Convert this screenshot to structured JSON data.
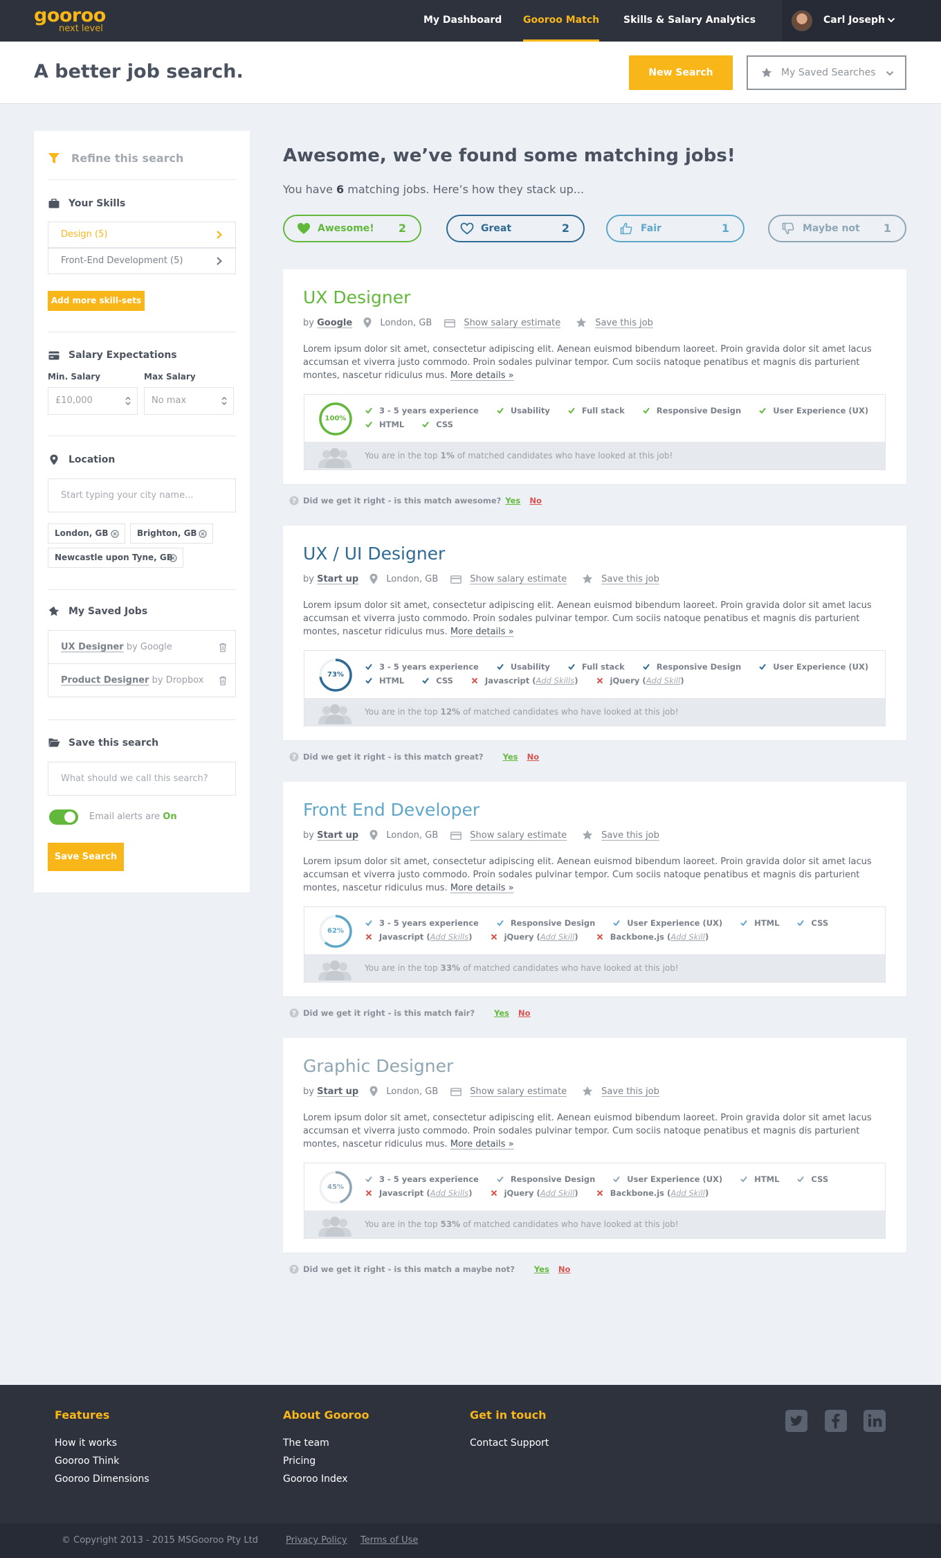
{
  "brand": {
    "name": "gooroo",
    "tagline": "next level",
    "accent": "#f8b619"
  },
  "nav": {
    "links": [
      "My Dashboard",
      "Gooroo Match",
      "Skills & Salary Analytics"
    ],
    "active": "Gooroo Match",
    "user_name": "Carl Joseph"
  },
  "header": {
    "title": "A better job search.",
    "new_search": "New Search",
    "saved_searches": "My Saved Searches"
  },
  "sidebar": {
    "refine": "Refine this search",
    "skills_title": "Your Skills",
    "skills": [
      {
        "label": "Design (5)",
        "active": true
      },
      {
        "label": "Front-End Development (5)",
        "active": false
      }
    ],
    "add_skills": "Add more skill-sets",
    "salary_title": "Salary Expectations",
    "min_label": "Min. Salary",
    "max_label": "Max Salary",
    "min_value": "£10,000",
    "max_value": "No max",
    "location_title": "Location",
    "location_placeholder": "Start typing your city name...",
    "locations": [
      "London, GB",
      "Brighton, GB",
      "Newcastle upon Tyne, GB"
    ],
    "saved_jobs_title": "My Saved Jobs",
    "saved_jobs": [
      {
        "title": "UX Designer",
        "by": "by Google"
      },
      {
        "title": "Product Designer",
        "by": "by Dropbox"
      }
    ],
    "save_search_title": "Save this search",
    "save_placeholder": "What should we call this search?",
    "alerts_label": "Email alerts are",
    "alerts_state": "On",
    "save_button": "Save Search"
  },
  "main": {
    "title": "Awesome, we’ve found some matching jobs!",
    "sub_prefix": "You have",
    "sub_count": "6",
    "sub_suffix": "matching jobs. Here’s how they stack up...",
    "filters": [
      {
        "label": "Awesome!",
        "count": "2",
        "color": "#61b83a",
        "icon": "heart-filled-icon"
      },
      {
        "label": "Great",
        "count": "2",
        "color": "#2e6a93",
        "icon": "heart-outline-icon"
      },
      {
        "label": "Fair",
        "count": "1",
        "color": "#5ea7c9",
        "icon": "thumbs-up-icon"
      },
      {
        "label": "Maybe not",
        "count": "1",
        "color": "#8fa6b5",
        "icon": "thumbs-down-icon"
      }
    ]
  },
  "common": {
    "by": "by",
    "location": "London, GB",
    "salary": "Show salary estimate",
    "save_job": "Save this job",
    "description": "Lorem ipsum dolor sit amet, consectetur adipiscing elit. Aenean euismod bibendum laoreet. Proin gravida dolor sit amet lacus accumsan et viverra justo commodo. Proin sodales pulvinar tempor. Cum sociis natoque penatibus et magnis dis parturient montes, nascetur ridiculus mus.",
    "more": "More details »",
    "top_prefix": "You are in the top",
    "top_suffix": "of matched candidates who have looked at this job!",
    "question_prefix": "Did we get it right - is this match",
    "yes": "Yes",
    "no": "No",
    "add_skills": "Add Skills",
    "add_skill": "Add Skill"
  },
  "jobs": [
    {
      "title": "UX Designer",
      "company": "Google",
      "color": "#61b83a",
      "match": 100,
      "match_label": "100%",
      "top": "1%",
      "rating_word": "awesome?",
      "skills_row1": [
        {
          "name": "3 - 5 years experience",
          "ok": true
        },
        {
          "name": "Usability",
          "ok": true
        },
        {
          "name": "Full stack",
          "ok": true
        },
        {
          "name": "Responsive Design",
          "ok": true
        },
        {
          "name": "User Experience (UX)",
          "ok": true
        }
      ],
      "skills_row2": [
        {
          "name": "HTML",
          "ok": true
        },
        {
          "name": "CSS",
          "ok": true
        }
      ]
    },
    {
      "title": "UX / UI Designer",
      "company": "Start up",
      "color": "#2e6a93",
      "match": 73,
      "match_label": "73%",
      "top": "12%",
      "rating_word": "great?",
      "skills_row1": [
        {
          "name": "3 - 5 years experience",
          "ok": true
        },
        {
          "name": "Usability",
          "ok": true
        },
        {
          "name": "Full stack",
          "ok": true
        },
        {
          "name": "Responsive Design",
          "ok": true
        },
        {
          "name": "User Experience (UX)",
          "ok": true
        }
      ],
      "skills_row2": [
        {
          "name": "HTML",
          "ok": true
        },
        {
          "name": "CSS",
          "ok": true
        },
        {
          "name": "Javascript",
          "ok": false,
          "add": "Add Skills"
        },
        {
          "name": "jQuery",
          "ok": false,
          "add": "Add Skill"
        }
      ]
    },
    {
      "title": "Front End Developer",
      "company": "Start up",
      "color": "#5ea7c9",
      "match": 62,
      "match_label": "62%",
      "top": "33%",
      "rating_word": "fair?",
      "skills_row1": [
        {
          "name": "3 - 5 years experience",
          "ok": true
        },
        {
          "name": "Responsive Design",
          "ok": true
        },
        {
          "name": "User Experience (UX)",
          "ok": true
        },
        {
          "name": "HTML",
          "ok": true
        },
        {
          "name": "CSS",
          "ok": true
        }
      ],
      "skills_row2": [
        {
          "name": "Javascript",
          "ok": false,
          "add": "Add Skills"
        },
        {
          "name": "jQuery",
          "ok": false,
          "add": "Add Skill"
        },
        {
          "name": "Backbone.js",
          "ok": false,
          "add": "Add Skill"
        }
      ]
    },
    {
      "title": "Graphic Designer",
      "company": "Start up",
      "color": "#8fa6b5",
      "match": 45,
      "match_label": "45%",
      "top": "53%",
      "rating_word": "a maybe not?",
      "skills_row1": [
        {
          "name": "3 - 5 years experience",
          "ok": true
        },
        {
          "name": "Responsive Design",
          "ok": true
        },
        {
          "name": "User Experience (UX)",
          "ok": true
        },
        {
          "name": "HTML",
          "ok": true
        },
        {
          "name": "CSS",
          "ok": true
        }
      ],
      "skills_row2": [
        {
          "name": "Javascript",
          "ok": false,
          "add": "Add Skills"
        },
        {
          "name": "jQuery",
          "ok": false,
          "add": "Add Skill"
        },
        {
          "name": "Backbone.js",
          "ok": false,
          "add": "Add Skill"
        }
      ]
    }
  ],
  "footer": {
    "features_title": "Features",
    "features": [
      "How it works",
      "Gooroo Think",
      "Gooroo Dimensions"
    ],
    "about_title": "About Gooroo",
    "about": [
      "The team",
      "Pricing",
      "Gooroo Index"
    ],
    "contact_title": "Get in touch",
    "contact": [
      "Contact Support"
    ],
    "copyright": "© Copyright 2013 - 2015 MSGooroo Pty Ltd",
    "privacy": "Privacy Policy",
    "terms": "Terms of Use",
    "social": [
      "twitter-icon",
      "facebook-icon",
      "linkedin-icon"
    ]
  }
}
